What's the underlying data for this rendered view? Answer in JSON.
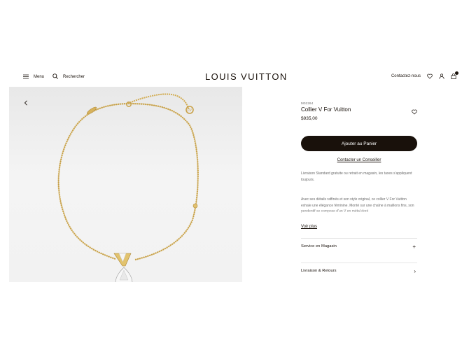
{
  "header": {
    "menu_label": "Menu",
    "search_label": "Rechercher",
    "brand": "LOUIS VUITTON",
    "contact_label": "Contactez-nous",
    "bag_count": ""
  },
  "product": {
    "sku": "M02264",
    "title": "Collier V For Vuitton",
    "price": "$935,00",
    "add_to_cart": "Ajouter au Panier",
    "contact_advisor": "Contacter un Conseiller",
    "shipping_note": "Livraison Standard gratuite ou retrait en magasin, les taxes s'appliquent toujours.",
    "description": "Avec ses détails raffinés et son style original, ce collier V For Vuitton exhale une élégance féminine. Monté sur une chaîne à maillons fins, son pendentif se compose d'un V en métal doré",
    "see_more": "Voir plus"
  },
  "accordion": [
    {
      "label": "Service en Magasin",
      "symbol": "+"
    },
    {
      "label": "Livraison & Retours",
      "symbol": "›"
    }
  ],
  "colors": {
    "text": "#19110b",
    "gold": "#d9b75a",
    "panel": "#eeeeee"
  }
}
